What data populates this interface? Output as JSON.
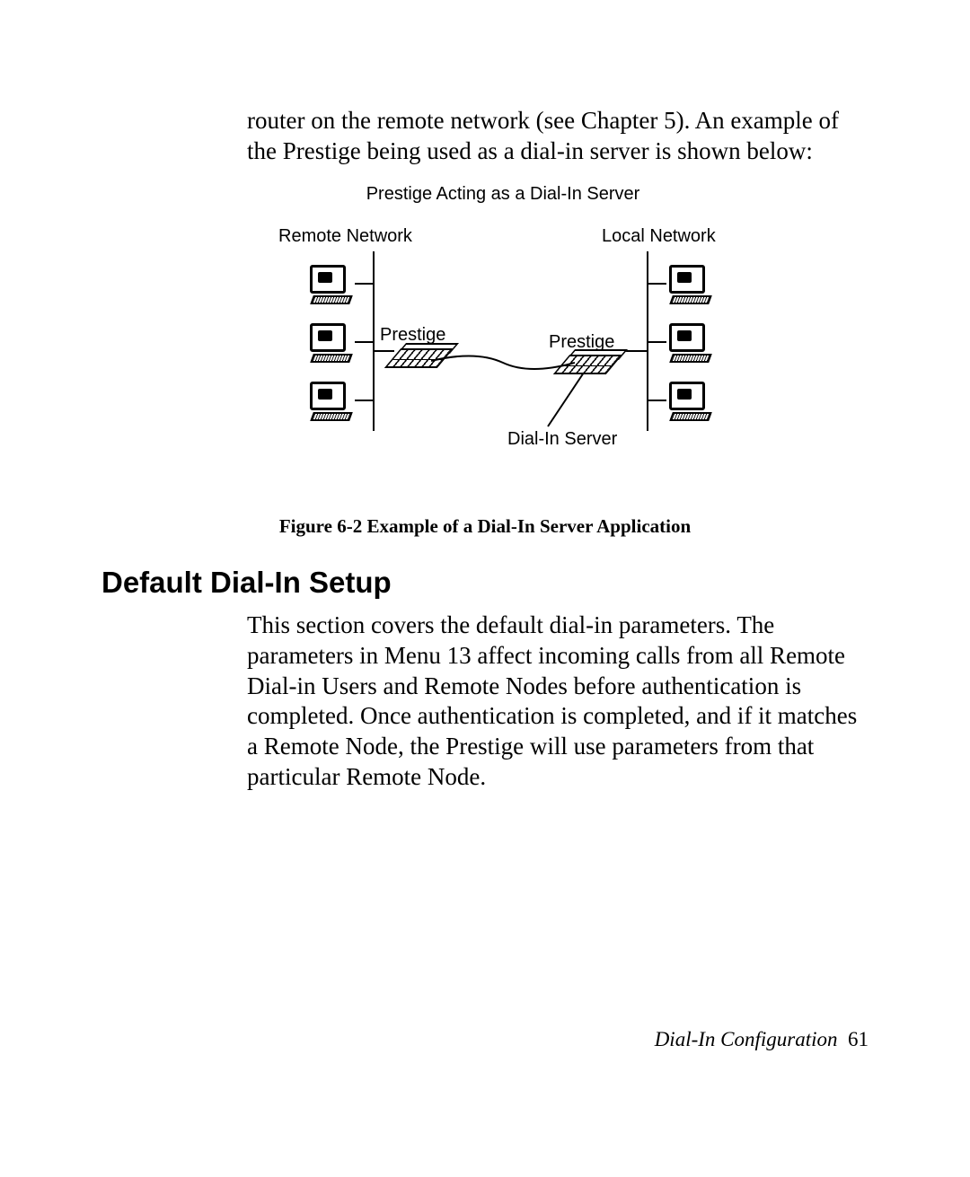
{
  "paragraph_top": "router on the remote network (see Chapter 5). An example of the Prestige being used as a dial-in server is shown below:",
  "diagram": {
    "title": "Prestige Acting as a Dial-In Server",
    "remote_label": "Remote Network",
    "local_label": "Local Network",
    "prestige_left": "Prestige",
    "prestige_right": "Prestige",
    "dialin_label": "Dial-In Server"
  },
  "caption": "Figure 6-2 Example of a Dial-In Server Application",
  "heading": "Default Dial-In Setup",
  "paragraph_body": "This section covers the default dial-in parameters. The parameters in Menu 13 affect incoming calls from all Remote Dial-in Users and Remote Nodes before authentication is completed. Once authentication is completed, and if it matches a Remote Node, the Prestige will use parameters from that particular Remote Node.",
  "footer_section": "Dial-In Configuration",
  "footer_page": "61"
}
